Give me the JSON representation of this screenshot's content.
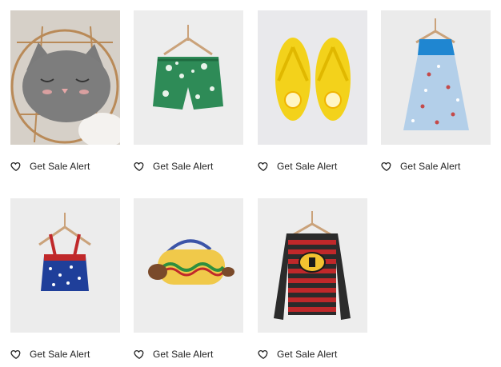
{
  "products": [
    {
      "image_icon": "cat-pillow-image",
      "alert_label": "Get Sale Alert"
    },
    {
      "image_icon": "swim-shorts-image",
      "alert_label": "Get Sale Alert"
    },
    {
      "image_icon": "flip-flops-image",
      "alert_label": "Get Sale Alert"
    },
    {
      "image_icon": "dress-image",
      "alert_label": "Get Sale Alert"
    },
    {
      "image_icon": "tankini-top-image",
      "alert_label": "Get Sale Alert"
    },
    {
      "image_icon": "hotdog-bag-image",
      "alert_label": "Get Sale Alert"
    },
    {
      "image_icon": "striped-sweater-image",
      "alert_label": "Get Sale Alert"
    }
  ],
  "icons": {
    "heart": "heart-outline-icon"
  }
}
